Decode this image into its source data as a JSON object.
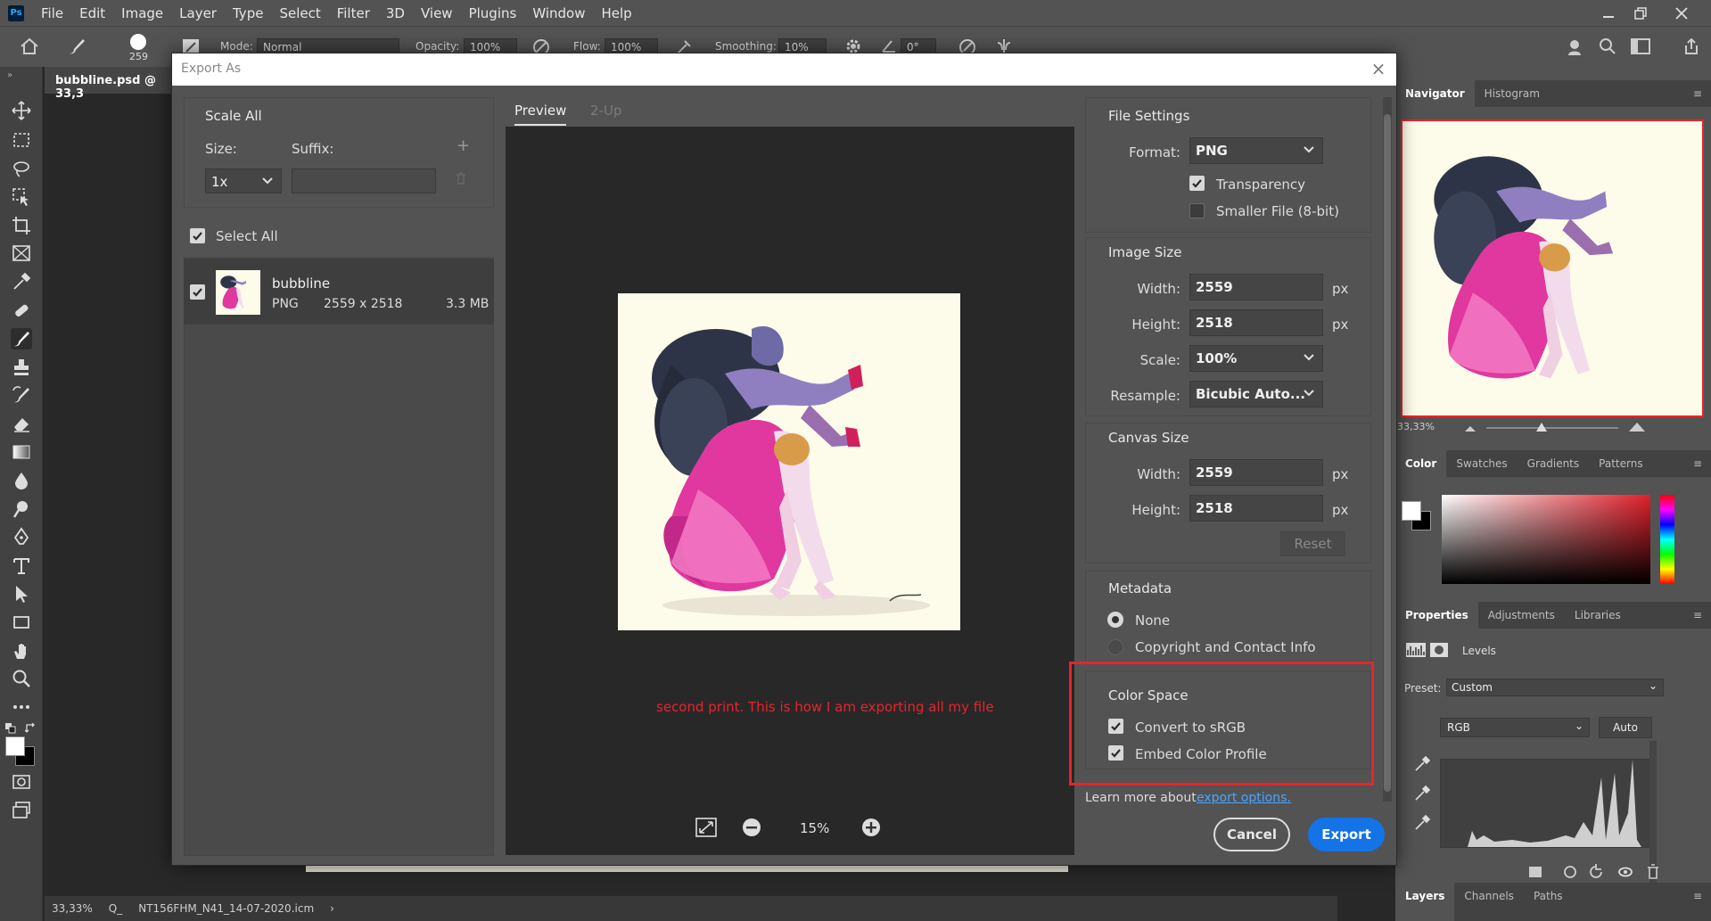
{
  "app": {
    "logo": "Ps",
    "menu": [
      "File",
      "Edit",
      "Image",
      "Layer",
      "Type",
      "Select",
      "Filter",
      "3D",
      "View",
      "Plugins",
      "Window",
      "Help"
    ]
  },
  "options_bar": {
    "brush_size": "259",
    "mode_label": "Mode:",
    "mode_value": "Normal",
    "opacity_label": "Opacity:",
    "opacity_value": "100%",
    "flow_label": "Flow:",
    "flow_value": "100%",
    "smoothing_label": "Smoothing:",
    "smoothing_value": "10%",
    "angle_value": "0°"
  },
  "document": {
    "tab_title": "bubbline.psd @ 33,3",
    "status_zoom": "33,33%",
    "status_extra": "Q_",
    "status_profile": "NT156FHM_N41_14-07-2020.icm"
  },
  "dialog": {
    "title": "Export As",
    "scale_all": {
      "title": "Scale All",
      "size_label": "Size:",
      "suffix_label": "Suffix:",
      "size_value": "1x",
      "suffix_value": ""
    },
    "select_all_label": "Select All",
    "asset": {
      "name": "bubbline",
      "format": "PNG",
      "dimensions": "2559 x 2518",
      "filesize": "3.3 MB"
    },
    "preview_tabs": [
      "Preview",
      "2-Up"
    ],
    "annotation": "second print. This is how I am exporting all my file",
    "zoom": "15%",
    "file_settings": {
      "title": "File Settings",
      "format_label": "Format:",
      "format_value": "PNG",
      "transparency_label": "Transparency",
      "transparency_checked": true,
      "smaller_file_label": "Smaller File (8-bit)",
      "smaller_file_checked": false
    },
    "image_size": {
      "title": "Image Size",
      "width_label": "Width:",
      "width_value": "2559",
      "height_label": "Height:",
      "height_value": "2518",
      "unit": "px",
      "scale_label": "Scale:",
      "scale_value": "100%",
      "resample_label": "Resample:",
      "resample_value": "Bicubic Auto..."
    },
    "canvas_size": {
      "title": "Canvas Size",
      "width_label": "Width:",
      "width_value": "2559",
      "height_label": "Height:",
      "height_value": "2518",
      "unit": "px",
      "reset_label": "Reset"
    },
    "metadata": {
      "title": "Metadata",
      "none_label": "None",
      "copyright_label": "Copyright and Contact Info",
      "selected": "None"
    },
    "color_space": {
      "title": "Color Space",
      "convert_label": "Convert to sRGB",
      "convert_checked": true,
      "embed_label": "Embed Color Profile",
      "embed_checked": true
    },
    "learn_more_text": "Learn more about",
    "learn_more_link": "export options.",
    "cancel_label": "Cancel",
    "export_label": "Export"
  },
  "panels": {
    "navigator_tabs": [
      "Navigator",
      "Histogram"
    ],
    "navigator_zoom": "33,33%",
    "color_tabs": [
      "Color",
      "Swatches",
      "Gradients",
      "Patterns"
    ],
    "properties_tabs": [
      "Properties",
      "Adjustments",
      "Libraries"
    ],
    "properties_type": "Levels",
    "preset_label": "Preset:",
    "preset_value": "Custom",
    "channel_value": "RGB",
    "auto_label": "Auto",
    "layers_tabs": [
      "Layers",
      "Channels",
      "Paths"
    ]
  },
  "colors": {
    "accent": "#1473e6",
    "highlight_box": "#e8242a",
    "annotation": "#e8242a",
    "link": "#4aa4ff"
  }
}
